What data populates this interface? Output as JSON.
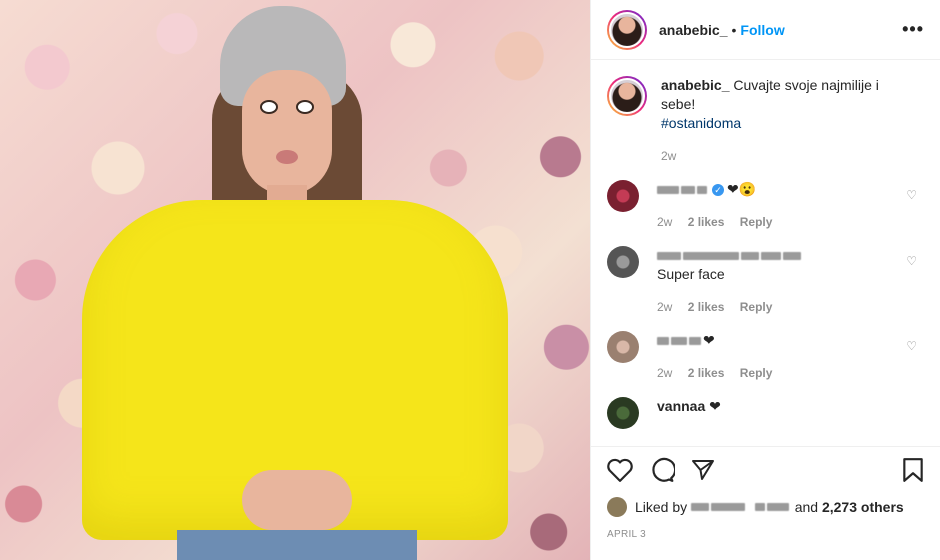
{
  "post": {
    "username": "anabebic_",
    "follow_label": "Follow",
    "separator": "•",
    "more_label": "•••"
  },
  "caption": {
    "username": "anabebic_",
    "text": "Cuvajte svoje najmilije i sebe!",
    "hashtag": "#ostanidoma",
    "time": "2w"
  },
  "comments": [
    {
      "user": "████ ███",
      "text": "❤😮",
      "time": "2w",
      "likes": "2 likes",
      "reply": "Reply",
      "verified": true
    },
    {
      "user": "████ ████████ ███ ███",
      "text": "Super face",
      "time": "2w",
      "likes": "2 likes",
      "reply": "Reply",
      "verified": false
    },
    {
      "user": "██ ██ ██",
      "text": "❤",
      "time": "2w",
      "likes": "2 likes",
      "reply": "Reply",
      "verified": false
    },
    {
      "user": "vannaa",
      "text": "❤",
      "time": "",
      "likes": "",
      "reply": "",
      "verified": false
    }
  ],
  "likes": {
    "prefix": "Liked by",
    "and": "and",
    "count": "2,273 others"
  },
  "date": "APRIL 3",
  "icons": {
    "like": "heart-icon",
    "comment": "comment-icon",
    "share": "paper-plane-icon",
    "save": "bookmark-icon"
  },
  "colors": {
    "link": "#0095f6",
    "hashtag": "#00376b",
    "muted": "#8e8e8e",
    "sweater": "#f5e51a"
  }
}
